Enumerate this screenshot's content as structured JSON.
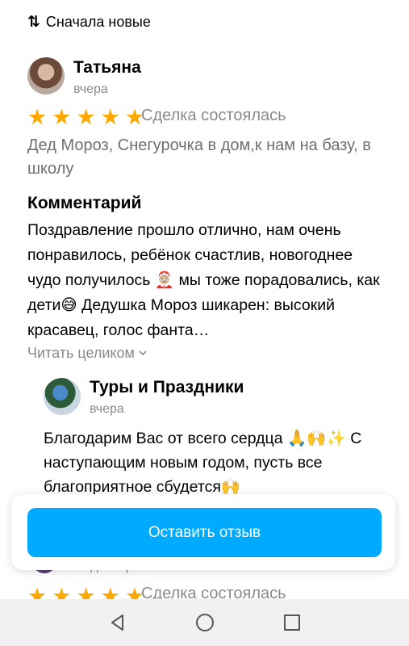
{
  "sort": {
    "icon": "sort-arrows-icon",
    "label": "Сначала новые"
  },
  "review": {
    "author": "Татьяна",
    "date": "вчера",
    "rating": 5,
    "deal_status": "Сделка состоялась",
    "service": "Дед Мороз, Снегурочка в дом,к нам на базу, в школу",
    "comment_title": "Комментарий",
    "comment_text": "Поздравление прошло отлично, нам очень понравилось, ребёнок счастлив, новогоднее чудо получилось 🤶🏼 мы тоже порадовались, как дети😅 Дедушка Мороз шикарен: высокий красавец, голос фанта…",
    "read_more": "Читать целиком",
    "reply": {
      "author": "Туры и Праздники",
      "date": "вчера",
      "text": "Благодарим Вас от всего сердца 🙏🙌✨ С наступающим новым годом, пусть все благоприятное сбудется🙌"
    }
  },
  "next_review": {
    "date": "30 декабря 2022",
    "deal_status": "Сделка состоялась"
  },
  "leave_review_button": "Оставить отзыв",
  "colors": {
    "accent": "#00aaff",
    "star": "#ffa800",
    "muted": "#8a8a8a"
  },
  "navbar": {
    "icons": [
      "back-icon",
      "home-icon",
      "recent-apps-icon"
    ]
  }
}
